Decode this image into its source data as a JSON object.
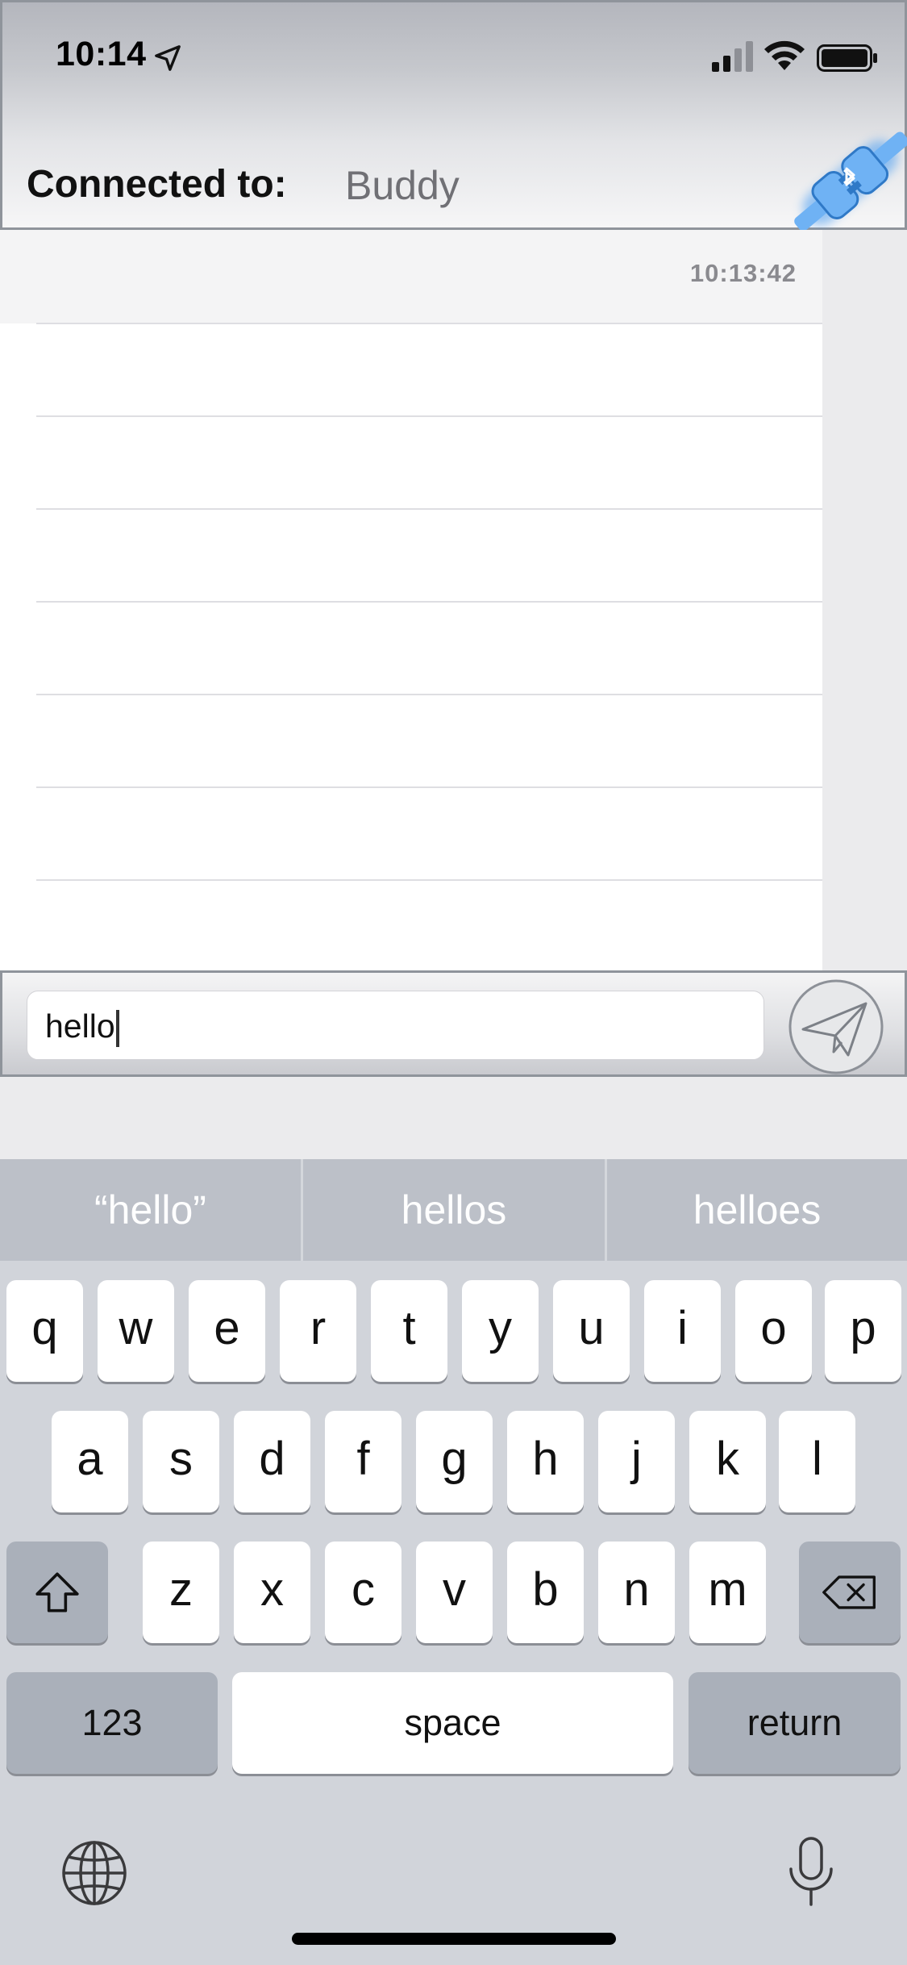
{
  "status_bar": {
    "time": "10:14",
    "icons": [
      "location-arrow-icon",
      "cellular-signal-icon",
      "wifi-icon",
      "battery-icon"
    ]
  },
  "connection": {
    "label": "Connected to:",
    "device_name": "Buddy",
    "status_icon": "bluetooth-plug-icon",
    "accent_color": "#4a9df2"
  },
  "chat": {
    "messages": [
      {
        "time": "10:13:42",
        "text": ""
      }
    ]
  },
  "composer": {
    "input_value": "hello",
    "send_icon": "paper-plane-icon"
  },
  "keyboard": {
    "suggestions": [
      "“hello”",
      "hellos",
      "helloes"
    ],
    "rows": [
      [
        "q",
        "w",
        "e",
        "r",
        "t",
        "y",
        "u",
        "i",
        "o",
        "p"
      ],
      [
        "a",
        "s",
        "d",
        "f",
        "g",
        "h",
        "j",
        "k",
        "l"
      ],
      [
        "z",
        "x",
        "c",
        "v",
        "b",
        "n",
        "m"
      ]
    ],
    "numbers_key": "123",
    "space_key": "space",
    "return_key": "return",
    "shift_icon": "shift-icon",
    "delete_icon": "delete-icon",
    "globe_icon": "globe-icon",
    "mic_icon": "microphone-icon"
  }
}
